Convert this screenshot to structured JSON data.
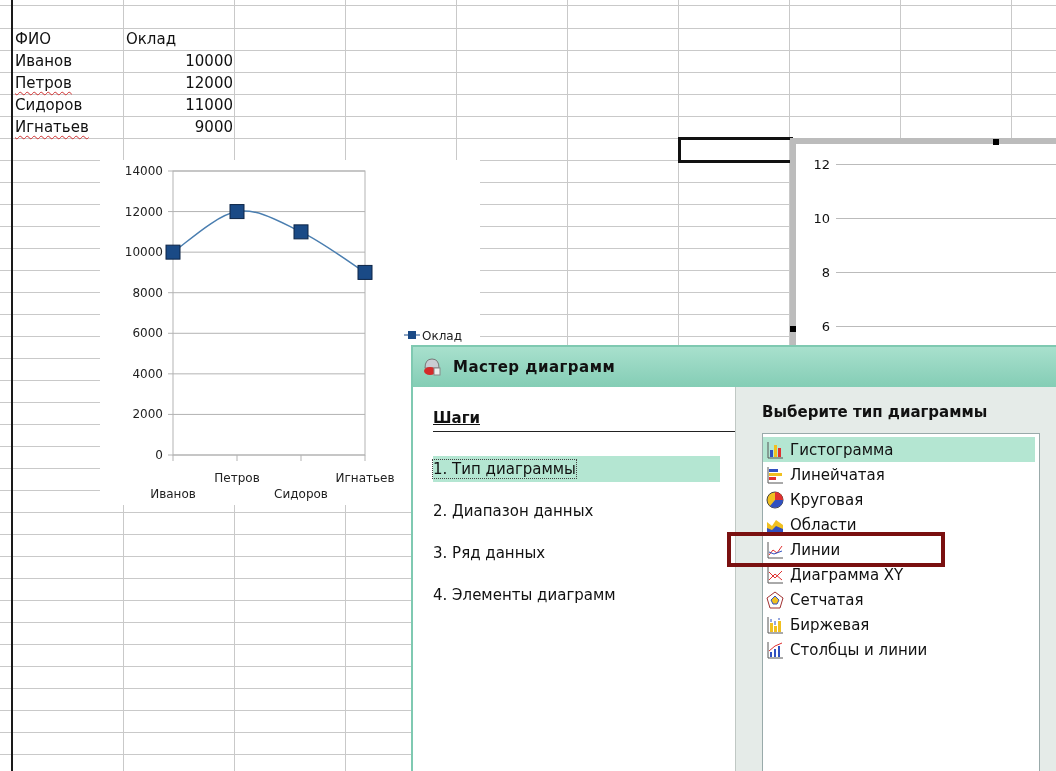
{
  "sheet": {
    "header": [
      "ФИО",
      "Оклад"
    ],
    "rows": [
      {
        "name": "Иванов",
        "value": "10000",
        "spell_error": false
      },
      {
        "name": "Петров",
        "value": "12000",
        "spell_error": true
      },
      {
        "name": "Сидоров",
        "value": "11000",
        "spell_error": false
      },
      {
        "name": "Игнатьев",
        "value": "9000",
        "spell_error": true
      }
    ]
  },
  "chart": {
    "chart_data": {
      "type": "line",
      "categories": [
        "Иванов",
        "Петров",
        "Сидоров",
        "Игнатьев"
      ],
      "series": [
        {
          "name": "Оклад",
          "color": "#1a4a86",
          "marker": "square",
          "values": [
            10000,
            12000,
            11000,
            9000
          ]
        }
      ],
      "grid": true,
      "ylim": [
        0,
        14000
      ],
      "yticks": [
        0,
        2000,
        4000,
        6000,
        8000,
        10000,
        12000,
        14000
      ]
    }
  },
  "second_chart": {
    "ytick_labels": [
      "12",
      "10",
      "8",
      "6"
    ]
  },
  "dialog": {
    "title": "Мастер диаграмм",
    "steps_heading": "Шаги",
    "steps": [
      {
        "label": "1. Тип диаграммы",
        "selected": true
      },
      {
        "label": "2. Диапазон данных",
        "selected": false
      },
      {
        "label": "3. Ряд данных",
        "selected": false
      },
      {
        "label": "4. Элементы диаграмм",
        "selected": false
      }
    ],
    "types_heading": "Выберите тип диаграммы",
    "chart_types": [
      {
        "label": "Гистограмма",
        "kind": "column",
        "selected": true,
        "annotated": false
      },
      {
        "label": "Линейчатая",
        "kind": "bar",
        "selected": false,
        "annotated": false
      },
      {
        "label": "Круговая",
        "kind": "pie",
        "selected": false,
        "annotated": false
      },
      {
        "label": "Области",
        "kind": "area",
        "selected": false,
        "annotated": false
      },
      {
        "label": "Линии",
        "kind": "line",
        "selected": false,
        "annotated": true
      },
      {
        "label": "Диаграмма XY",
        "kind": "xy",
        "selected": false,
        "annotated": false
      },
      {
        "label": "Сетчатая",
        "kind": "net",
        "selected": false,
        "annotated": false
      },
      {
        "label": "Биржевая",
        "kind": "stock",
        "selected": false,
        "annotated": false
      },
      {
        "label": "Столбцы и линии",
        "kind": "columnline",
        "selected": false,
        "annotated": false
      }
    ]
  }
}
